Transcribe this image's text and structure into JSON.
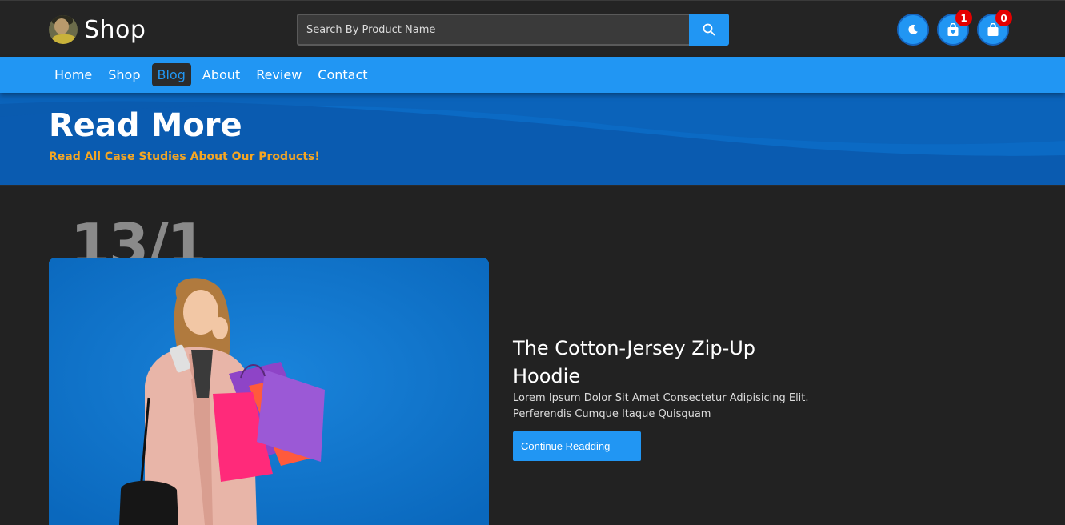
{
  "header": {
    "brand_name": "Shop",
    "search_placeholder": "Search By Product Name",
    "wishlist_count": "1",
    "cart_count": "0"
  },
  "nav": {
    "items": [
      {
        "label": "Home"
      },
      {
        "label": "Shop"
      },
      {
        "label": "Blog"
      },
      {
        "label": "About"
      },
      {
        "label": "Review"
      },
      {
        "label": "Contact"
      }
    ],
    "active": "Blog"
  },
  "hero": {
    "title": "Read More",
    "subtitle": "Read All Case Studies About Our Products!"
  },
  "post": {
    "date": "13/1",
    "title": "The Cotton-Jersey Zip-Up Hoodie",
    "excerpt": "Lorem Ipsum Dolor Sit Amet Consectetur Adipisicing Elit. Perferendis Cumque Itaque Quisquam",
    "button_label": "Continue Readding"
  },
  "colors": {
    "accent": "#2196f3",
    "background": "#222222",
    "header_bg": "#242424",
    "subtitle": "#f5a623",
    "badge": "#e50000"
  },
  "icons": {
    "search": "search-icon",
    "theme": "moon-icon",
    "wishlist": "heart-bag-icon",
    "cart": "shopping-bag-icon"
  }
}
